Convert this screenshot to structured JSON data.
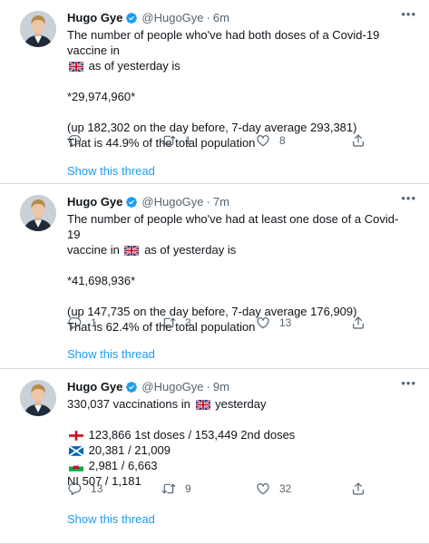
{
  "tweets": [
    {
      "name": "Hugo Gye",
      "handle": "@HugoGye",
      "dot": "·",
      "time": "6m",
      "lines": {
        "l1": "The number of people who've had both doses of a Covid-19 vaccine in",
        "l2_post": "as of yesterday is",
        "l3": "*29,974,960*",
        "l4": "(up 182,302 on the day before, 7-day average 293,381)",
        "l5": "That is 44.9% of the total population"
      },
      "reply_count": "",
      "retweet_count": "1",
      "like_count": "8",
      "show_thread": "Show this thread"
    },
    {
      "name": "Hugo Gye",
      "handle": "@HugoGye",
      "dot": "·",
      "time": "7m",
      "lines": {
        "l1": "The number of people who've had at least one dose of a Covid-19",
        "l2_pre": "vaccine in",
        "l2_post": "as of yesterday is",
        "l3": "*41,698,936*",
        "l4": "(up 147,735 on the day before, 7-day average 176,909)",
        "l5": "That is 62.4% of the total population"
      },
      "reply_count": "1",
      "retweet_count": "3",
      "like_count": "13",
      "show_thread": "Show this thread"
    },
    {
      "name": "Hugo Gye",
      "handle": "@HugoGye",
      "dot": "·",
      "time": "9m",
      "lines": {
        "l1_pre": "330,037 vaccinations in",
        "l1_post": "yesterday",
        "england": "123,866 1st doses / 153,449 2nd doses",
        "scotland": "20,381 / 21,009",
        "wales": "2,981 / 6,663",
        "ni": "NI 507 / 1,181"
      },
      "reply_count": "13",
      "retweet_count": "9",
      "like_count": "32",
      "show_thread": "Show this thread"
    }
  ],
  "icons": {
    "verified": "verified-badge-icon",
    "more": "more-options-icon",
    "reply": "reply-icon",
    "retweet": "retweet-icon",
    "like": "like-icon",
    "share": "share-icon",
    "uk_flag": "uk-flag-icon",
    "england_flag": "england-flag-icon",
    "scotland_flag": "scotland-flag-icon",
    "wales_flag": "wales-flag-icon"
  },
  "colors": {
    "link": "#1d9bf0",
    "secondary_text": "#536471",
    "divider": "#cfd9de"
  }
}
